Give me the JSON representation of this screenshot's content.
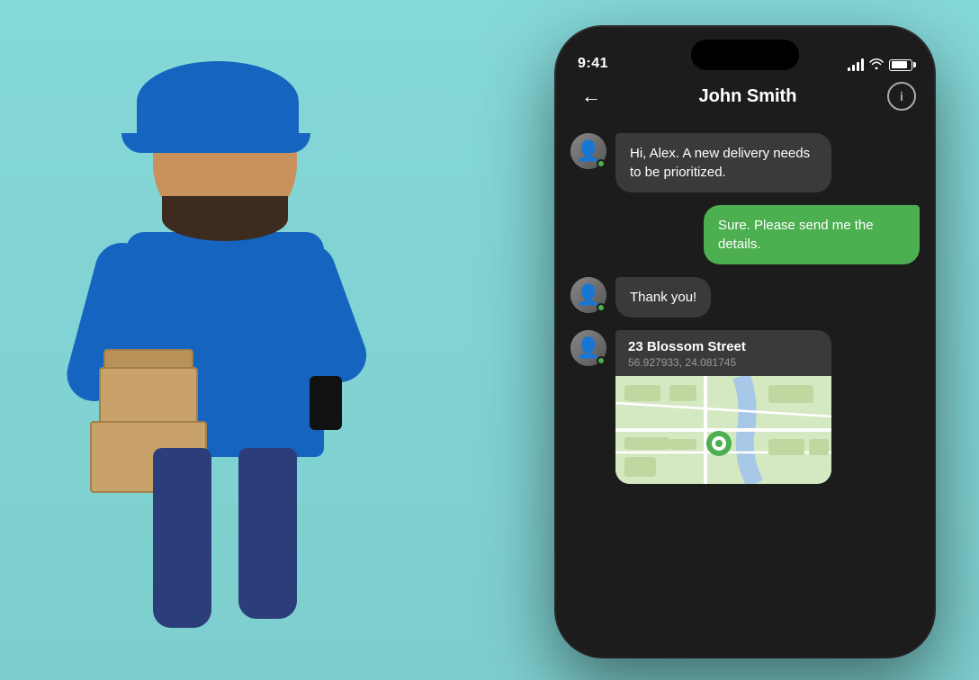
{
  "background_color": "#85d8d8",
  "phone": {
    "status_bar": {
      "time": "9:41",
      "signal_label": "signal",
      "wifi_label": "wifi",
      "battery_label": "battery"
    },
    "chat_header": {
      "back_label": "←",
      "contact_name": "John Smith",
      "info_label": "i"
    },
    "messages": [
      {
        "id": "msg1",
        "type": "received",
        "avatar": true,
        "online": true,
        "text": "Hi, Alex. A new delivery needs to be prioritized."
      },
      {
        "id": "msg2",
        "type": "sent",
        "text": "Sure. Please send me the details."
      },
      {
        "id": "msg3",
        "type": "received",
        "avatar": true,
        "online": true,
        "text": "Thank you!"
      },
      {
        "id": "msg4",
        "type": "location",
        "avatar": true,
        "online": true,
        "location_name": "23 Blossom Street",
        "coordinates": "56.927933, 24.081745"
      }
    ]
  },
  "delivery_person": {
    "description": "Smiling delivery man in blue uniform holding phone and boxes"
  }
}
